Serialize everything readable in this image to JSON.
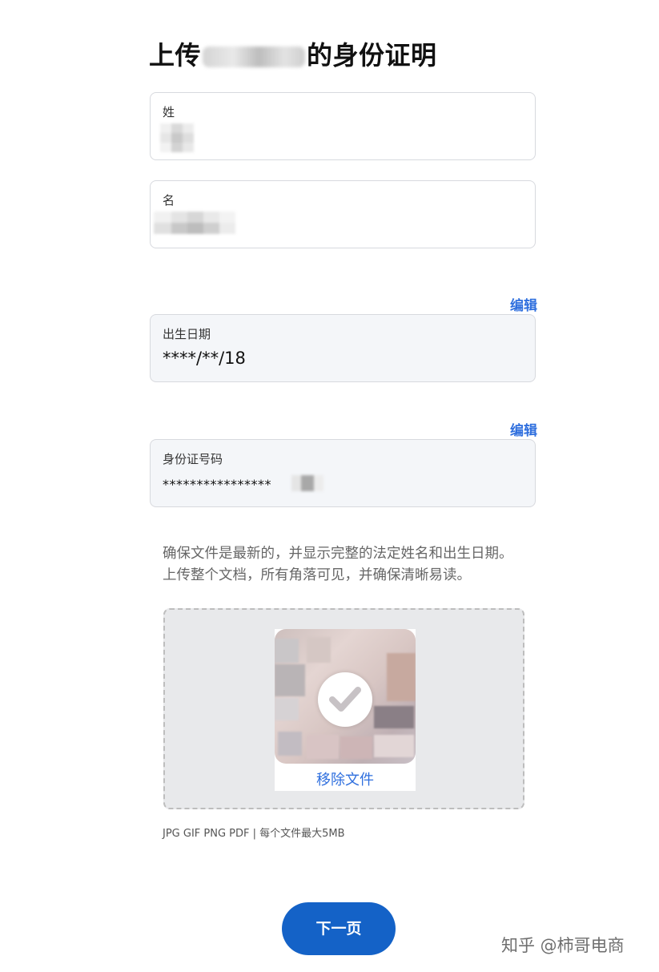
{
  "header": {
    "title_prefix": "上传",
    "title_suffix": "的身份证明"
  },
  "form": {
    "last_name": {
      "label": "姓",
      "value": ""
    },
    "first_name": {
      "label": "名",
      "value": ""
    },
    "birth_date": {
      "edit_label": "编辑",
      "label": "出生日期",
      "value": "****/**/18"
    },
    "id_number": {
      "edit_label": "编辑",
      "label": "身份证号码",
      "value": "****************"
    }
  },
  "upload": {
    "instructions": [
      "确保文件是最新的，并显示完整的法定姓名和出生日期。",
      "上传整个文档，所有角落可见，并确保清晰易读。"
    ],
    "remove_label": "移除文件",
    "formats_note": "JPG GIF PNG PDF | 每个文件最大5MB"
  },
  "actions": {
    "next_label": "下一页"
  },
  "watermark": {
    "text": "知乎 @柿哥电商"
  },
  "icons": {
    "check": "check-circle-icon",
    "document": "document-thumbnail"
  },
  "colors": {
    "accent": "#2f6fde",
    "button": "#1462c7",
    "field_border": "#d7d9de",
    "readonly_bg": "#f4f6f9"
  }
}
